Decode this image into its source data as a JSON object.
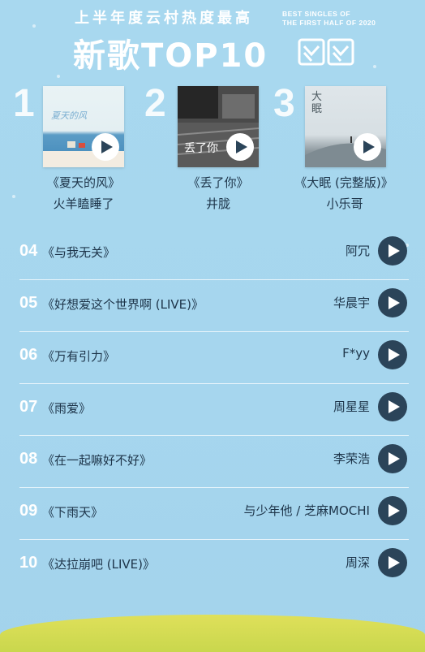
{
  "header": {
    "subtitle_cn": "上半年度云村热度最高",
    "subtitle_en_line1": "BEST SINGLES OF",
    "subtitle_en_line2": "THE FIRST HALF OF 2020",
    "title": "新歌TOP10"
  },
  "top3": [
    {
      "rank": "1",
      "title": "《夏天的风》",
      "artist": "火羊瞌睡了",
      "cover_text": "夏天的风"
    },
    {
      "rank": "2",
      "title": "《丢了你》",
      "artist": "井胧",
      "cover_text": "丢了你"
    },
    {
      "rank": "3",
      "title": "《大眠 (完整版)》",
      "artist": "小乐哥",
      "cover_text": "大眠"
    }
  ],
  "list": [
    {
      "num": "04",
      "title": "《与我无关》",
      "artist": "阿冗"
    },
    {
      "num": "05",
      "title": "《好想爱这个世界啊 (LIVE)》",
      "artist": "华晨宇"
    },
    {
      "num": "06",
      "title": "《万有引力》",
      "artist": "F*yy"
    },
    {
      "num": "07",
      "title": "《雨爱》",
      "artist": "周星星"
    },
    {
      "num": "08",
      "title": "《在一起嘛好不好》",
      "artist": "李荣浩"
    },
    {
      "num": "09",
      "title": "《下雨天》",
      "artist": "与少年他 / 芝麻MOCHI"
    },
    {
      "num": "10",
      "title": "《达拉崩吧 (LIVE)》",
      "artist": "周深"
    }
  ],
  "colors": {
    "background": "#a8d8ef",
    "play_button": "#2b4459",
    "ground": "#d6dc55"
  },
  "icons": {
    "play": "play-icon",
    "arrows": "double-chevron-icon"
  }
}
